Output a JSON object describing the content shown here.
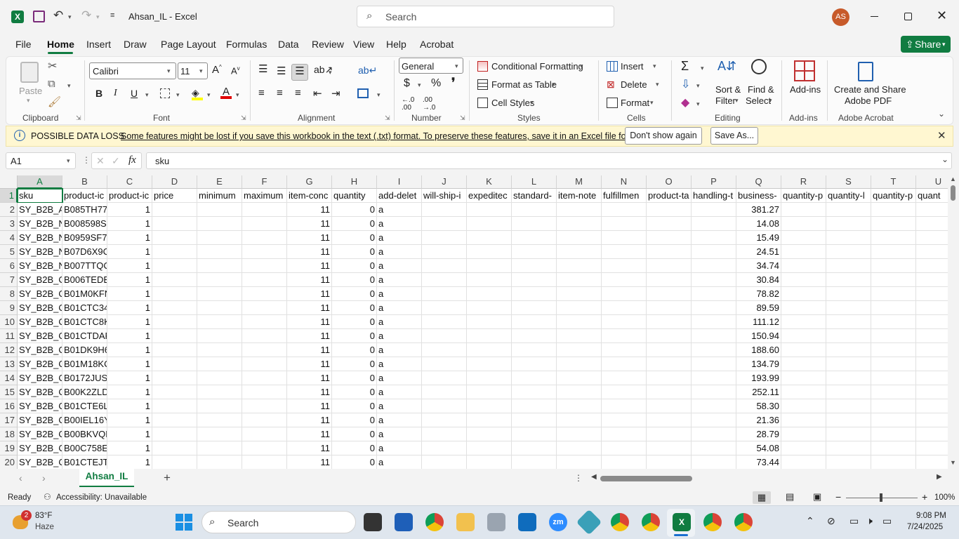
{
  "window": {
    "title": "Ahsan_IL  -  Excel",
    "search_placeholder": "Search",
    "user_initials": "AS"
  },
  "menu": {
    "file": "File",
    "home": "Home",
    "insert": "Insert",
    "draw": "Draw",
    "page_layout": "Page Layout",
    "formulas": "Formulas",
    "data": "Data",
    "review": "Review",
    "view": "View",
    "help": "Help",
    "acrobat": "Acrobat",
    "share": "Share"
  },
  "ribbon": {
    "paste": "Paste",
    "font_name": "Calibri",
    "font_size": "11",
    "number_format": "General",
    "conditional_formatting": "Conditional Formatting",
    "format_as_table": "Format as Table",
    "cell_styles": "Cell Styles",
    "insert": "Insert",
    "delete": "Delete",
    "format": "Format",
    "sort_filter_1": "Sort &",
    "sort_filter_2": "Filter",
    "find_select_1": "Find &",
    "find_select_2": "Select",
    "addins": "Add-ins",
    "create_pdf_1": "Create and Share",
    "create_pdf_2": "Adobe PDF",
    "groups": {
      "clipboard": "Clipboard",
      "font": "Font",
      "alignment": "Alignment",
      "number": "Number",
      "styles": "Styles",
      "cells": "Cells",
      "editing": "Editing",
      "addins": "Add-ins",
      "adobe": "Adobe Acrobat"
    }
  },
  "banner": {
    "title": "POSSIBLE DATA LOSS",
    "message": "Some features might be lost if you save this workbook in the text (.txt) format. To preserve these features, save it in an Excel file format.",
    "dont_show": "Don't show again",
    "save_as": "Save As..."
  },
  "formula_bar": {
    "name_box": "A1",
    "formula": "sku"
  },
  "columns": [
    "A",
    "B",
    "C",
    "D",
    "E",
    "F",
    "G",
    "H",
    "I",
    "J",
    "K",
    "L",
    "M",
    "N",
    "O",
    "P",
    "Q",
    "R",
    "S",
    "T",
    "U"
  ],
  "header_row": [
    "sku",
    "product-ic",
    "product-ic",
    "price",
    "minimum",
    "maximum",
    "item-conc",
    "quantity",
    "add-delet",
    "will-ship-i",
    "expeditec",
    "standard-",
    "item-note",
    "fulfillmen",
    "product-ta",
    "handling-t",
    "business-",
    "quantity-p",
    "quantity-l",
    "quantity-p",
    "quant"
  ],
  "rows": [
    {
      "n": "2",
      "a": "SY_B2B_A",
      "b": "B085TH77I",
      "c": "1",
      "g": "11",
      "h": "0",
      "i": "a",
      "q": "381.27"
    },
    {
      "n": "3",
      "a": "SY_B2B_N",
      "b": "B008598SI",
      "c": "1",
      "g": "11",
      "h": "0",
      "i": "a",
      "q": "14.08"
    },
    {
      "n": "4",
      "a": "SY_B2B_N",
      "b": "B0959SF7C",
      "c": "1",
      "g": "11",
      "h": "0",
      "i": "a",
      "q": "15.49"
    },
    {
      "n": "5",
      "a": "SY_B2B_N",
      "b": "B07D6X9C",
      "c": "1",
      "g": "11",
      "h": "0",
      "i": "a",
      "q": "24.51"
    },
    {
      "n": "6",
      "a": "SY_B2B_N",
      "b": "B007TTQC",
      "c": "1",
      "g": "11",
      "h": "0",
      "i": "a",
      "q": "34.74"
    },
    {
      "n": "7",
      "a": "SY_B2B_O",
      "b": "B006TEDEI",
      "c": "1",
      "g": "11",
      "h": "0",
      "i": "a",
      "q": "30.84"
    },
    {
      "n": "8",
      "a": "SY_B2B_O",
      "b": "B01M0KFN",
      "c": "1",
      "g": "11",
      "h": "0",
      "i": "a",
      "q": "78.82"
    },
    {
      "n": "9",
      "a": "SY_B2B_O",
      "b": "B01CTC34I",
      "c": "1",
      "g": "11",
      "h": "0",
      "i": "a",
      "q": "89.59"
    },
    {
      "n": "10",
      "a": "SY_B2B_O",
      "b": "B01CTC8K",
      "c": "1",
      "g": "11",
      "h": "0",
      "i": "a",
      "q": "111.12"
    },
    {
      "n": "11",
      "a": "SY_B2B_O",
      "b": "B01CTDAF",
      "c": "1",
      "g": "11",
      "h": "0",
      "i": "a",
      "q": "150.94"
    },
    {
      "n": "12",
      "a": "SY_B2B_O",
      "b": "B01DK9H6",
      "c": "1",
      "g": "11",
      "h": "0",
      "i": "a",
      "q": "188.60"
    },
    {
      "n": "13",
      "a": "SY_B2B_O",
      "b": "B01M18KC",
      "c": "1",
      "g": "11",
      "h": "0",
      "i": "a",
      "q": "134.79"
    },
    {
      "n": "14",
      "a": "SY_B2B_O",
      "b": "B0172JUS2",
      "c": "1",
      "g": "11",
      "h": "0",
      "i": "a",
      "q": "193.99"
    },
    {
      "n": "15",
      "a": "SY_B2B_O",
      "b": "B00K2ZLDI",
      "c": "1",
      "g": "11",
      "h": "0",
      "i": "a",
      "q": "252.11"
    },
    {
      "n": "16",
      "a": "SY_B2B_O",
      "b": "B01CTE6LE",
      "c": "1",
      "g": "11",
      "h": "0",
      "i": "a",
      "q": "58.30"
    },
    {
      "n": "17",
      "a": "SY_B2B_O",
      "b": "B00IEL16Y",
      "c": "1",
      "g": "11",
      "h": "0",
      "i": "a",
      "q": "21.36"
    },
    {
      "n": "18",
      "a": "SY_B2B_O",
      "b": "B00BKVQE",
      "c": "1",
      "g": "11",
      "h": "0",
      "i": "a",
      "q": "28.79"
    },
    {
      "n": "19",
      "a": "SY_B2B_O",
      "b": "B00C758EJ",
      "c": "1",
      "g": "11",
      "h": "0",
      "i": "a",
      "q": "54.08"
    },
    {
      "n": "20",
      "a": "SY_B2B_O",
      "b": "B01CTEJTN",
      "c": "1",
      "g": "11",
      "h": "0",
      "i": "a",
      "q": "73.44"
    }
  ],
  "sheet_tab": "Ahsan_IL",
  "status": {
    "ready": "Ready",
    "accessibility": "Accessibility: Unavailable",
    "zoom": "100%"
  },
  "taskbar": {
    "weather_temp": "83°F",
    "weather_desc": "Haze",
    "weather_badge": "2",
    "search": "Search",
    "time": "9:08 PM",
    "date": "7/24/2025"
  },
  "colors": {
    "excel_green": "#107c41",
    "selection": "#217346",
    "banner_bg": "#fff7d1",
    "avatar": "#c75a2a"
  }
}
